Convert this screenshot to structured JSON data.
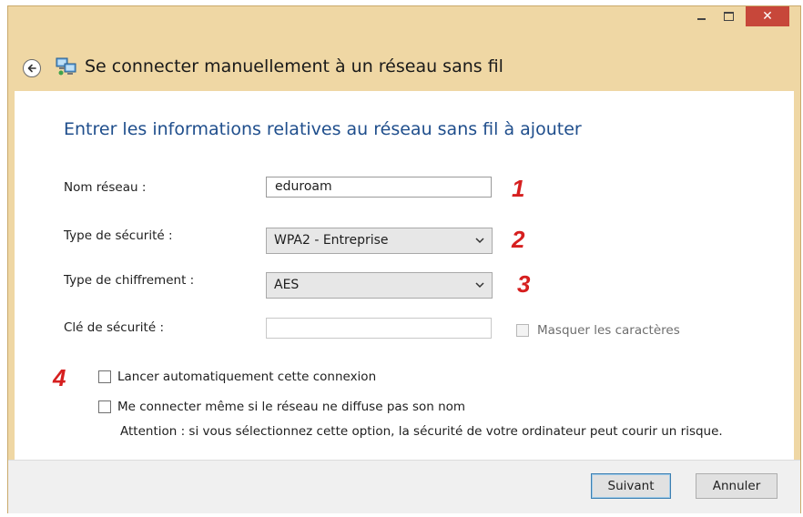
{
  "window": {
    "title": "Se connecter manuellement à un réseau sans fil",
    "controls": {
      "minimize": "–",
      "maximize": "□",
      "close": "✕"
    },
    "icons": {
      "back": "back-arrow-icon",
      "network": "network-icon"
    }
  },
  "form": {
    "heading": "Entrer les informations relatives au réseau sans fil à ajouter",
    "network_name": {
      "label": "Nom réseau :",
      "value": "eduroam",
      "step": "1"
    },
    "security_type": {
      "label": "Type de sécurité :",
      "value": "WPA2 - Entreprise",
      "step": "2"
    },
    "encryption_type": {
      "label": "Type de chiffrement :",
      "value": "AES",
      "step": "3"
    },
    "security_key": {
      "label": "Clé de sécurité :",
      "value": "",
      "hide_chars_label": "Masquer les caractères",
      "hide_chars_checked": false,
      "disabled": true
    },
    "auto_connect": {
      "label": "Lancer automatiquement cette connexion",
      "checked": false,
      "step": "4"
    },
    "connect_hidden": {
      "label": "Me connecter même si le réseau ne diffuse pas son nom",
      "checked": false
    },
    "warning": "Attention : si vous sélectionnez cette option, la sécurité de votre ordinateur peut courir un risque."
  },
  "footer": {
    "next_label": "Suivant",
    "cancel_label": "Annuler"
  },
  "colors": {
    "accent_heading": "#1f4e8c",
    "annotation_red": "#d61f1f",
    "window_frame": "#efd7a4",
    "close_button": "#c7473a"
  }
}
